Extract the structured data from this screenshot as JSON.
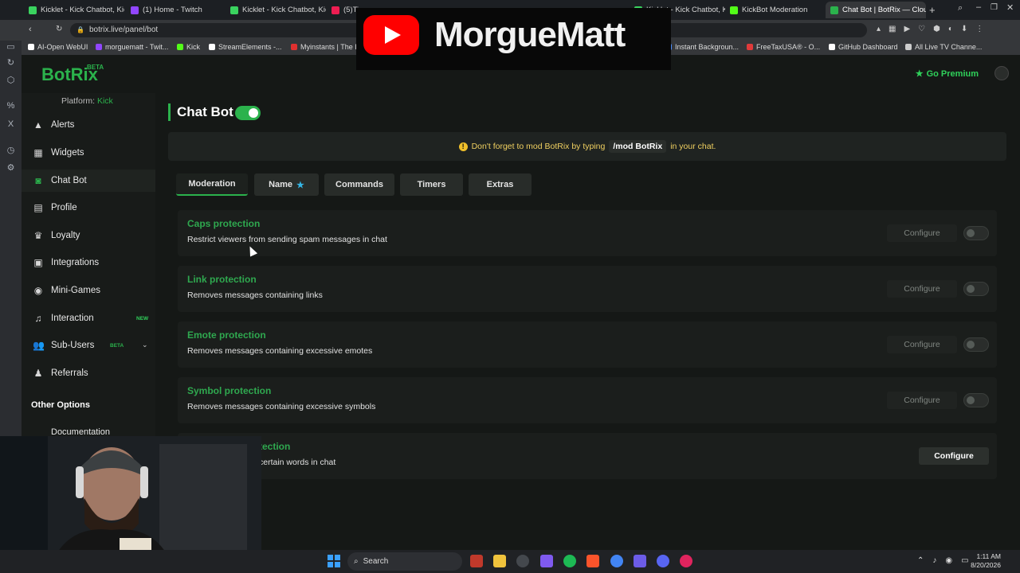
{
  "browser": {
    "tabs": [
      {
        "label": "Kicklet - Kick Chatbot, Kic",
        "color": "#3ad35f"
      },
      {
        "label": "(1) Home - Twitch",
        "color": "#9146ff"
      },
      {
        "label": "Kicklet - Kick Chatbot, Kic",
        "color": "#3ad35f"
      },
      {
        "label": "(5)Ti",
        "color": "#ee1d52"
      },
      {
        "label": "Kicklet - Kick Chatbot, Kic",
        "color": "#3ad35f"
      },
      {
        "label": "KickBot Moderation",
        "color": "#53fc18"
      },
      {
        "label": "Chat Bot | BotRix — Cloud",
        "color": "#2bb24c"
      }
    ],
    "url": "botrix.live/panel/bot",
    "bookmarks": [
      {
        "label": "AI-Open WebUI",
        "color": "#ffffff"
      },
      {
        "label": "morguematt - Twit...",
        "color": "#9146ff"
      },
      {
        "label": "Kick",
        "color": "#53fc18"
      },
      {
        "label": "StreamElements -...",
        "color": "#ffffff"
      },
      {
        "label": "Myinstants | The I",
        "color": "#e0302f"
      },
      {
        "label": "Instant Backgroun...",
        "color": "#4a8cff"
      },
      {
        "label": "FreeTaxUSA® - O...",
        "color": "#e03a3a"
      },
      {
        "label": "GitHub Dashboard",
        "color": "#ffffff"
      },
      {
        "label": "All Live TV Channe...",
        "color": "#cccccc"
      }
    ]
  },
  "overlay": {
    "channel_name": "MorgueMatt"
  },
  "app": {
    "logo": "BotRix",
    "logo_badge": "BETA",
    "premium_label": "Go Premium",
    "platform_label": "Platform:",
    "platform_value": "Kick",
    "nav": [
      {
        "label": "Alerts",
        "icon": "warning-icon"
      },
      {
        "label": "Widgets",
        "icon": "grid-icon"
      },
      {
        "label": "Chat Bot",
        "icon": "robot-icon",
        "active": true
      },
      {
        "label": "Profile",
        "icon": "id-card-icon"
      },
      {
        "label": "Loyalty",
        "icon": "trophy-icon"
      },
      {
        "label": "Integrations",
        "icon": "box-icon"
      },
      {
        "label": "Mini-Games",
        "icon": "gamepad-icon"
      },
      {
        "label": "Interaction",
        "icon": "music-icon",
        "badge": "NEW"
      },
      {
        "label": "Sub-Users",
        "icon": "users-icon",
        "badge": "BETA"
      },
      {
        "label": "Referrals",
        "icon": "people-icon"
      }
    ],
    "other_options_label": "Other Options",
    "documentation_label": "Documentation"
  },
  "main": {
    "title": "Chat Bot",
    "bot_enabled": true,
    "notice": {
      "before": "Don't forget to mod BotRix by typing",
      "code": "/mod BotRix",
      "after": "in your chat."
    },
    "tabs": [
      "Moderation",
      "Name",
      "Commands",
      "Timers",
      "Extras"
    ],
    "active_tab": "Moderation",
    "configure_label": "Configure",
    "cards": [
      {
        "title": "Caps protection",
        "desc": "Restrict viewers from sending spam messages in chat",
        "enabled": false
      },
      {
        "title": "Link protection",
        "desc": "Removes messages containing links",
        "enabled": false
      },
      {
        "title": "Emote protection",
        "desc": "Removes messages containing excessive emotes",
        "enabled": false
      },
      {
        "title": "Symbol protection",
        "desc": "Removes messages containing excessive symbols",
        "enabled": false
      },
      {
        "title": "tection",
        "desc": "certain words in chat",
        "enabled": true
      }
    ]
  },
  "taskbar": {
    "search_placeholder": "Search",
    "time": "1:11 AM",
    "date": "8/20/2026"
  }
}
